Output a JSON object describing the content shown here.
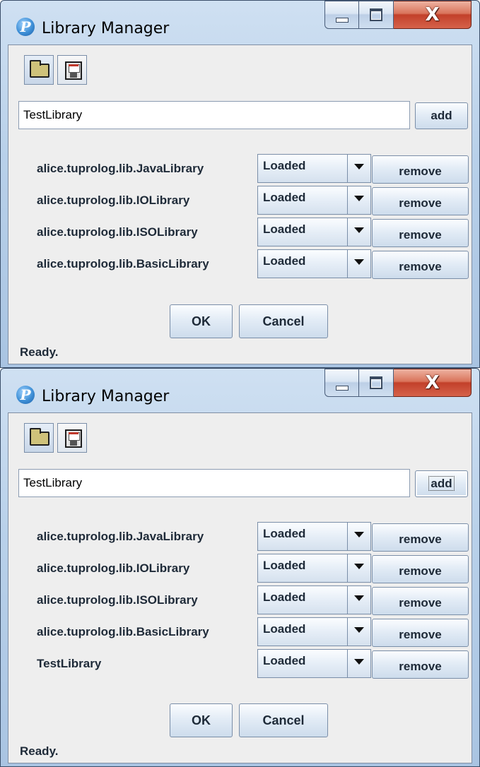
{
  "windows": [
    {
      "title": "Library Manager",
      "library_input": "TestLibrary",
      "add_label": "add",
      "libraries": [
        {
          "name": "alice.tuprolog.lib.JavaLibrary",
          "state": "Loaded",
          "remove_label": "remove"
        },
        {
          "name": "alice.tuprolog.lib.IOLibrary",
          "state": "Loaded",
          "remove_label": "remove"
        },
        {
          "name": "alice.tuprolog.lib.ISOLibrary",
          "state": "Loaded",
          "remove_label": "remove"
        },
        {
          "name": "alice.tuprolog.lib.BasicLibrary",
          "state": "Loaded",
          "remove_label": "remove"
        }
      ],
      "ok_label": "OK",
      "cancel_label": "Cancel",
      "status": "Ready."
    },
    {
      "title": "Library Manager",
      "library_input": "TestLibrary",
      "add_label": "add",
      "libraries": [
        {
          "name": "alice.tuprolog.lib.JavaLibrary",
          "state": "Loaded",
          "remove_label": "remove"
        },
        {
          "name": "alice.tuprolog.lib.IOLibrary",
          "state": "Loaded",
          "remove_label": "remove"
        },
        {
          "name": "alice.tuprolog.lib.ISOLibrary",
          "state": "Loaded",
          "remove_label": "remove"
        },
        {
          "name": "alice.tuprolog.lib.BasicLibrary",
          "state": "Loaded",
          "remove_label": "remove"
        },
        {
          "name": "TestLibrary",
          "state": "Loaded",
          "remove_label": "remove"
        }
      ],
      "ok_label": "OK",
      "cancel_label": "Cancel",
      "status": "Ready."
    }
  ],
  "app_icon_glyph": "P",
  "close_glyph": "X",
  "colors": {
    "close_button": "#c2402a",
    "client_background": "#eeeeee",
    "frame": "#b9d1ea"
  }
}
